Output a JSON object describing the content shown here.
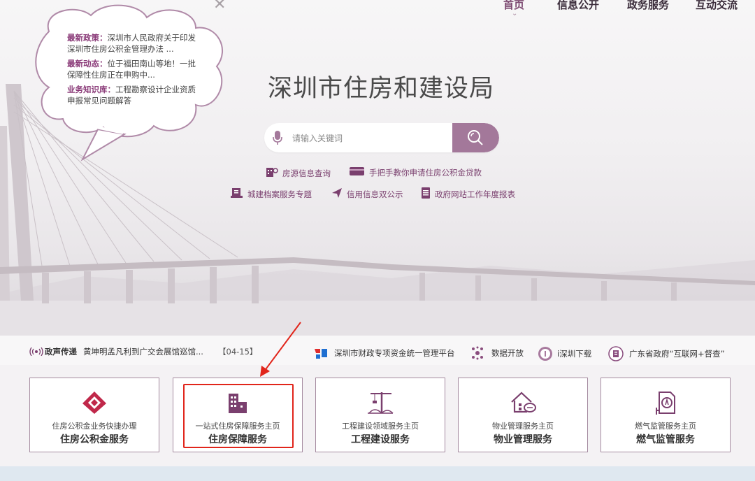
{
  "nav": {
    "items": [
      {
        "label": "首页",
        "active": true
      },
      {
        "label": "信息公开",
        "active": false
      },
      {
        "label": "政务服务",
        "active": false
      },
      {
        "label": "互动交流",
        "active": false
      }
    ],
    "caret": "⌄"
  },
  "bubble": {
    "close": "✕",
    "items": [
      {
        "tag": "最新政策：",
        "text": "深圳市人民政府关于印发深圳市住房公积金管理办法 ..."
      },
      {
        "tag": "最新动态：",
        "text": "位于福田南山等地！一批保障性住房正在申购中..."
      },
      {
        "tag": "业务知识库：",
        "text": "工程勘察设计企业资质申报常见问题解答"
      }
    ]
  },
  "title": "深圳市住房和建设局",
  "search": {
    "placeholder": "请输入关键词",
    "mic_icon": "microphone-icon",
    "button_icon": "search-icon"
  },
  "quick_links": {
    "row1": [
      {
        "icon": "building-search-icon",
        "label": "房源信息查询"
      },
      {
        "icon": "card-icon",
        "label": "手把手教你申请住房公积金贷款"
      }
    ],
    "row2": [
      {
        "icon": "archive-icon",
        "label": "城建档案服务专题"
      },
      {
        "icon": "paper-plane-icon",
        "label": "信用信息双公示"
      },
      {
        "icon": "document-icon",
        "label": "政府网站工作年度报表"
      }
    ]
  },
  "ticker": {
    "label": "政声传递",
    "headline": "黄坤明孟凡利到广交会展馆巡馆...",
    "date": "【04-15】",
    "links": [
      {
        "icon": "finance-platform-icon",
        "label": "深圳市财政专项资金统一管理平台"
      },
      {
        "icon": "data-open-icon",
        "label": "数据开放"
      },
      {
        "icon": "i-shenzhen-icon",
        "label": "i深圳下载"
      },
      {
        "icon": "guangdong-gov-icon",
        "label": "广东省政府“互联网+督查”"
      }
    ]
  },
  "cards": [
    {
      "icon": "housing-fund-icon",
      "sub": "住房公积金业务快捷办理",
      "main": "住房公积金服务"
    },
    {
      "icon": "housing-security-icon",
      "sub": "一站式住房保障服务主页",
      "main": "住房保障服务"
    },
    {
      "icon": "construction-crane-icon",
      "sub": "工程建设领域服务主页",
      "main": "工程建设服务"
    },
    {
      "icon": "property-management-icon",
      "sub": "物业管理服务主页",
      "main": "物业管理服务"
    },
    {
      "icon": "gas-supervision-icon",
      "sub": "燃气监管服务主页",
      "main": "燃气监管服务"
    }
  ],
  "colors": {
    "brand": "#7d4a72",
    "search_button": "#a3789a",
    "highlight": "#e1251b"
  }
}
